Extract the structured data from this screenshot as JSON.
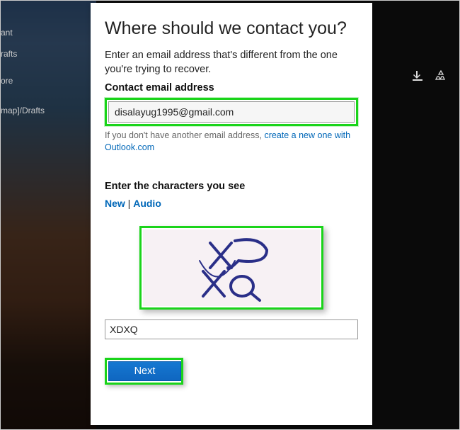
{
  "background": {
    "sidebar_items": [
      "ant",
      "rafts",
      "ore",
      "map]/Drafts"
    ]
  },
  "panel": {
    "title": "Where should we contact you?",
    "subtitle": "Enter an email address that's different from the one you're trying to recover.",
    "email_label": "Contact email address",
    "email_value": "disalayug1995@gmail.com",
    "helper_prefix": "If you don't have another email address, ",
    "helper_link": "create a new one with Outlook.com",
    "captcha_label": "Enter the characters you see",
    "captcha_links": {
      "new": "New",
      "audio": "Audio",
      "sep": " | "
    },
    "captcha_text": "XDXQ",
    "captcha_input_value": "XDXQ",
    "next_label": "Next"
  },
  "colors": {
    "highlight": "#1ad41a",
    "link": "#0067b8",
    "primary_button": "#1678d1"
  }
}
